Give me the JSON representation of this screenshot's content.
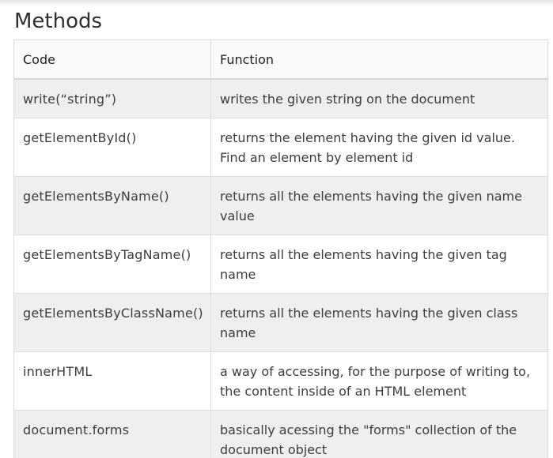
{
  "heading": "Methods",
  "table": {
    "headers": [
      "Code",
      "Function"
    ],
    "rows": [
      {
        "code": "write(“string”)",
        "function": "writes the given string on the document"
      },
      {
        "code": "getElementById()",
        "function": "returns the element having the given id value. Find an element by element id"
      },
      {
        "code": "getElementsByName()",
        "function": "returns all the elements having the given name value"
      },
      {
        "code": "getElementsByTagName()",
        "function": "returns all the elements having the given tag name"
      },
      {
        "code": "getElementsByClassName()",
        "function": "returns all the elements having the given class name"
      },
      {
        "code": "innerHTML",
        "function": "a way of accessing, for the purpose of writing to, the content inside of an HTML element"
      },
      {
        "code": "document.forms",
        "function": "basically acessing the \"forms\" collection of the document object"
      }
    ]
  }
}
